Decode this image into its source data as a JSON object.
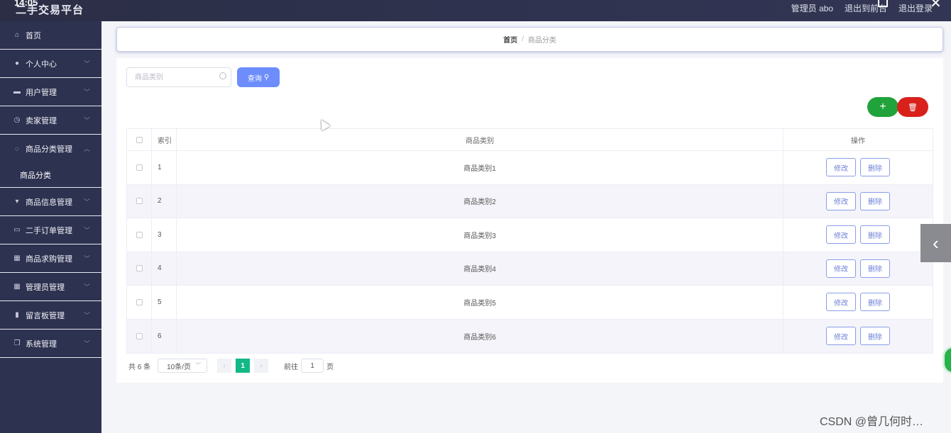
{
  "header": {
    "clock": "14:05",
    "title": "二手交易平台",
    "user_label": "管理员 abo",
    "to_front_label": "退出到前台",
    "logout_label": "退出登录"
  },
  "sidebar": {
    "items": [
      {
        "label": "首页",
        "icon": "home-icon"
      },
      {
        "label": "个人中心",
        "icon": "person-icon"
      },
      {
        "label": "用户管理",
        "icon": "monitor-icon"
      },
      {
        "label": "卖家管理",
        "icon": "clock-icon"
      },
      {
        "label": "商品分类管理",
        "icon": "globe-icon"
      },
      {
        "label": "商品信息管理",
        "icon": "pin-icon"
      },
      {
        "label": "二手订单管理",
        "icon": "card-icon"
      },
      {
        "label": "商品求购管理",
        "icon": "grid-icon"
      },
      {
        "label": "管理员管理",
        "icon": "grid-icon"
      },
      {
        "label": "留言板管理",
        "icon": "chart-icon"
      },
      {
        "label": "系统管理",
        "icon": "copy-icon"
      }
    ],
    "submenu": {
      "label": "商品分类"
    }
  },
  "breadcrumb": {
    "home": "首页",
    "separator": "/",
    "current": "商品分类"
  },
  "search": {
    "placeholder": "商品类别",
    "button_label": "查询"
  },
  "toolbar": {
    "add_symbol": "+",
    "delete_symbol": "🗑"
  },
  "table": {
    "headers": {
      "index": "索引",
      "name": "商品类别",
      "ops": "操作"
    },
    "rows": [
      {
        "index": "1",
        "name": "商品类别1"
      },
      {
        "index": "2",
        "name": "商品类别2"
      },
      {
        "index": "3",
        "name": "商品类别3"
      },
      {
        "index": "4",
        "name": "商品类别4"
      },
      {
        "index": "5",
        "name": "商品类别5"
      },
      {
        "index": "6",
        "name": "商品类别6"
      }
    ],
    "edit_label": "修改",
    "delete_label": "删除"
  },
  "pagination": {
    "total": "共 6 条",
    "page_size": "10条/页",
    "current_page": "1",
    "goto_label": "前往",
    "goto_value": "1",
    "page_unit": "页"
  },
  "watermark": "CSDN @曾几何时…"
}
